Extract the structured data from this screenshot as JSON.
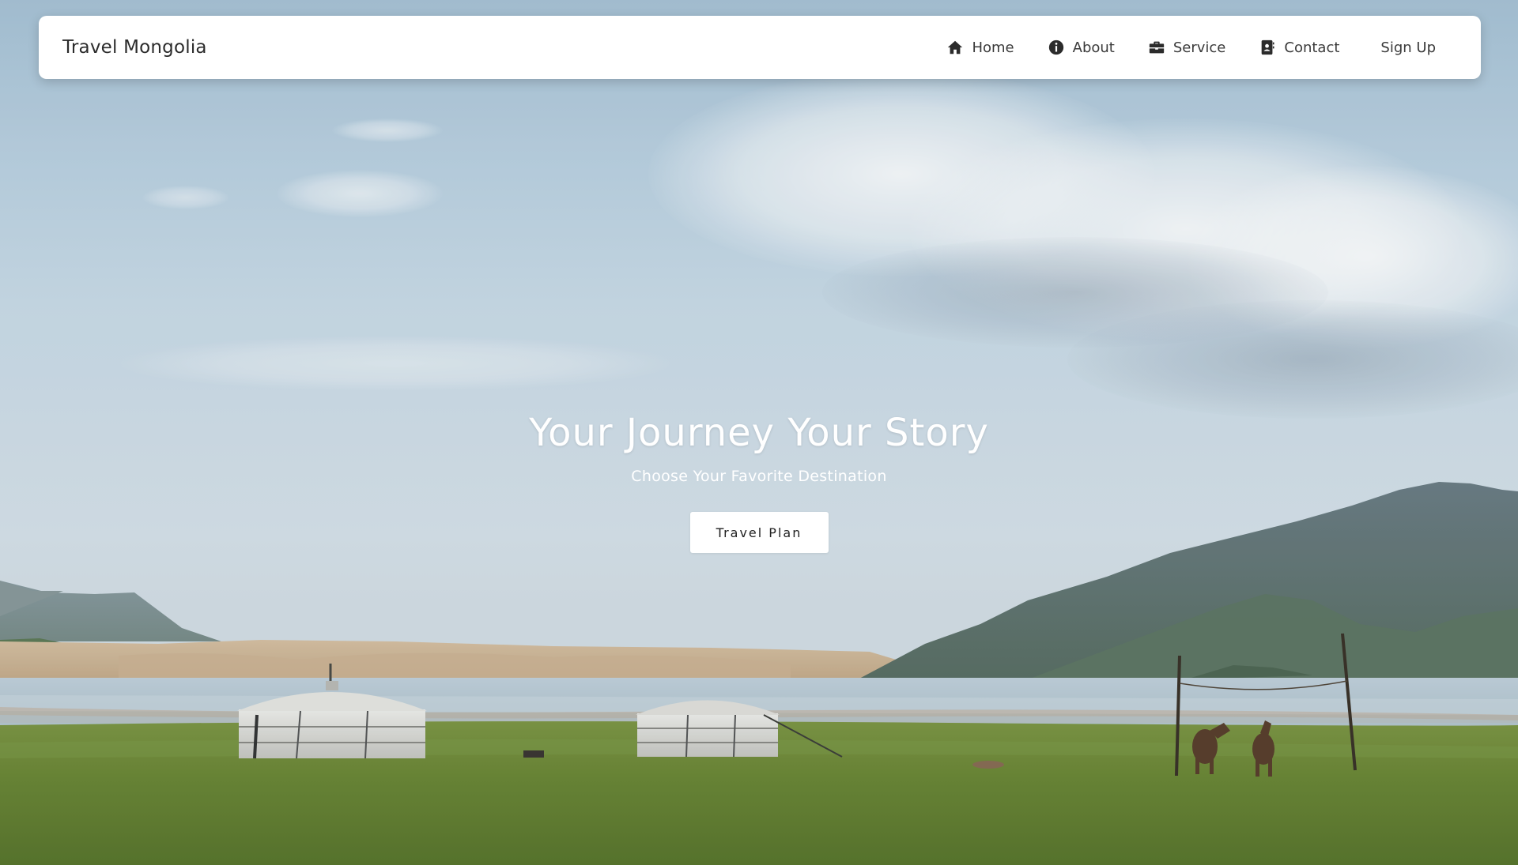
{
  "brand": {
    "title": "Travel Mongolia"
  },
  "nav": {
    "items": [
      {
        "label": "Home",
        "icon": "home-icon"
      },
      {
        "label": "About",
        "icon": "info-icon"
      },
      {
        "label": "Service",
        "icon": "briefcase-icon"
      },
      {
        "label": "Contact",
        "icon": "contact-card-icon"
      }
    ],
    "signup_label": "Sign Up"
  },
  "hero": {
    "title": "Your Journey Your Story",
    "subtitle": "Choose Your Favorite Destination",
    "cta_label": "Travel Plan"
  },
  "colors": {
    "navbar_bg": "#ffffff",
    "text_dark": "#2b2b2b",
    "hero_text": "#ffffff",
    "grass": "#6f8a35",
    "lake": "#b9c9d2"
  }
}
